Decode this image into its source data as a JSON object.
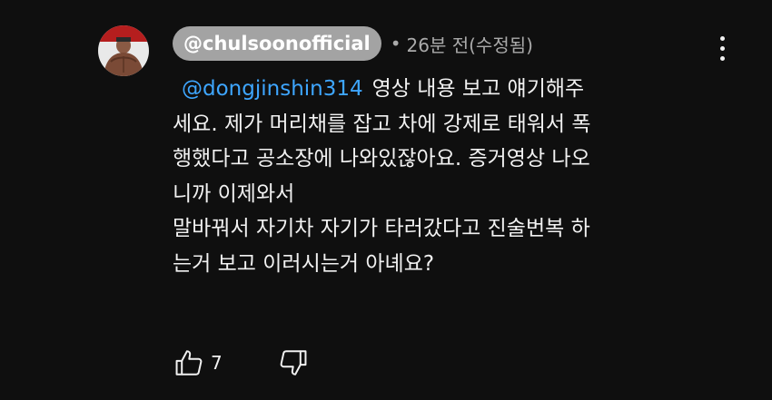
{
  "comment": {
    "author": "@chulsoonofficial",
    "separator": "•",
    "time": "26분 전(수정됨)",
    "mention": "@dongjinshin314",
    "lines": [
      "영상 내용 보고 얘기해주",
      "세요. 제가 머리채를 잡고 차에 강제로 태워서 폭",
      "행했다고 공소장에 나와있잖아요. 증거영상 나오",
      "니까 이제와서",
      "말바꿔서 자기차 자기가 타러갔다고 진술번복 하",
      "는거 보고 이러시는거 아녜요?"
    ],
    "like_count": "7"
  },
  "icons": {
    "avatar": "avatar-image",
    "menu": "more-vert-icon",
    "like": "thumb-up-icon",
    "dislike": "thumb-down-icon"
  },
  "colors": {
    "background": "#0f0f0f",
    "mention": "#3ea6ff",
    "author_chip": "#a3a3a3",
    "secondary_text": "#aaaaaa"
  }
}
